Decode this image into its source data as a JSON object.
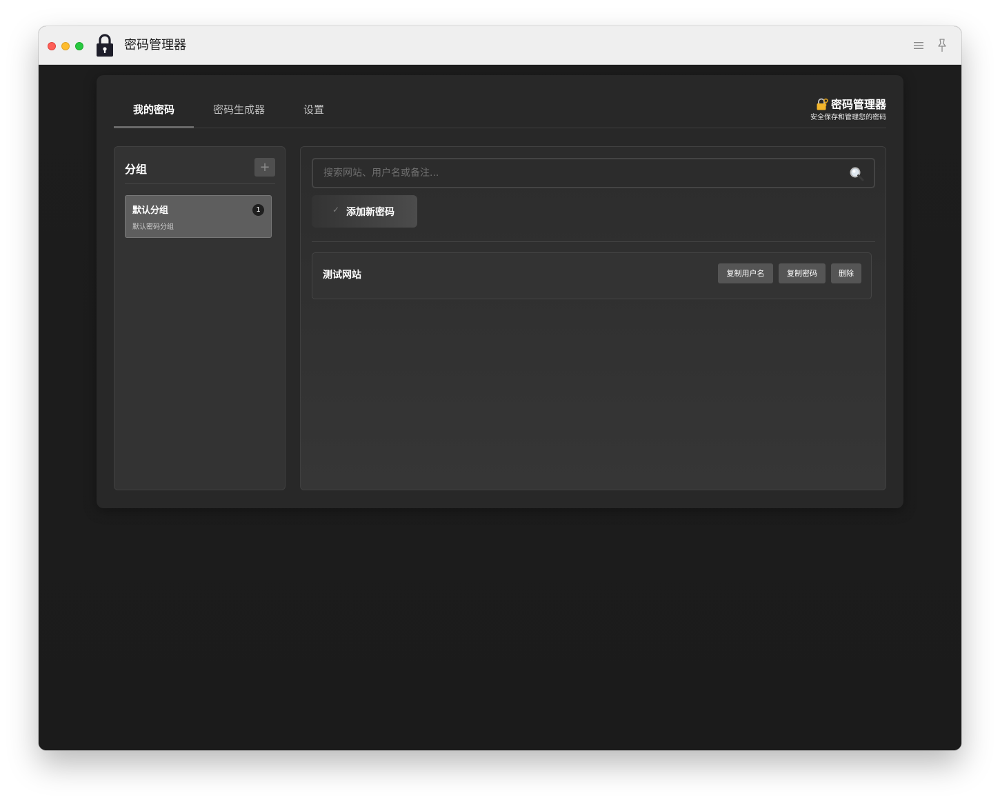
{
  "window": {
    "title": "密码管理器"
  },
  "tabs": [
    {
      "label": "我的密码",
      "active": true
    },
    {
      "label": "密码生成器",
      "active": false
    },
    {
      "label": "设置",
      "active": false
    }
  ],
  "brand": {
    "title": "密码管理器",
    "subtitle": "安全保存和管理您的密码"
  },
  "sidebar": {
    "title": "分组",
    "add_label": "+",
    "groups": [
      {
        "name": "默认分组",
        "description": "默认密码分组",
        "count": "1"
      }
    ]
  },
  "search": {
    "placeholder": "搜索网站、用户名或备注..."
  },
  "toolbar": {
    "add_label": "添加新密码",
    "add_check": "✓"
  },
  "entries": [
    {
      "name": "测试网站",
      "copy_user": "复制用户名",
      "copy_pass": "复制密码",
      "delete": "删除"
    }
  ],
  "colors": {
    "background": "#1c1c1c",
    "card": "#282828",
    "accent": "#6a6a6a"
  },
  "icons": {
    "app": "lock-icon",
    "brand": "locked-with-key-icon",
    "search": "magnifier-icon",
    "menu": "hamburger-icon",
    "pin": "pin-icon"
  }
}
